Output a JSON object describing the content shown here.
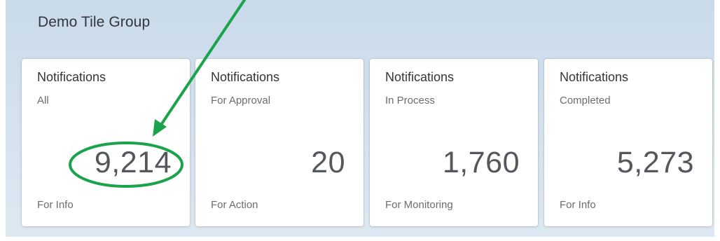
{
  "group": {
    "title": "Demo Tile Group"
  },
  "tiles": [
    {
      "title": "Notifications",
      "subtitle": "All",
      "value": "9,214",
      "footer": "For Info"
    },
    {
      "title": "Notifications",
      "subtitle": "For Approval",
      "value": "20",
      "footer": "For Action"
    },
    {
      "title": "Notifications",
      "subtitle": "In Process",
      "value": "1,760",
      "footer": "For Monitoring"
    },
    {
      "title": "Notifications",
      "subtitle": "Completed",
      "value": "5,273",
      "footer": "For Info"
    }
  ],
  "colors": {
    "annotation": "#1aa34a",
    "panel_background": "#c9daea",
    "tile_text": "#32363a"
  }
}
